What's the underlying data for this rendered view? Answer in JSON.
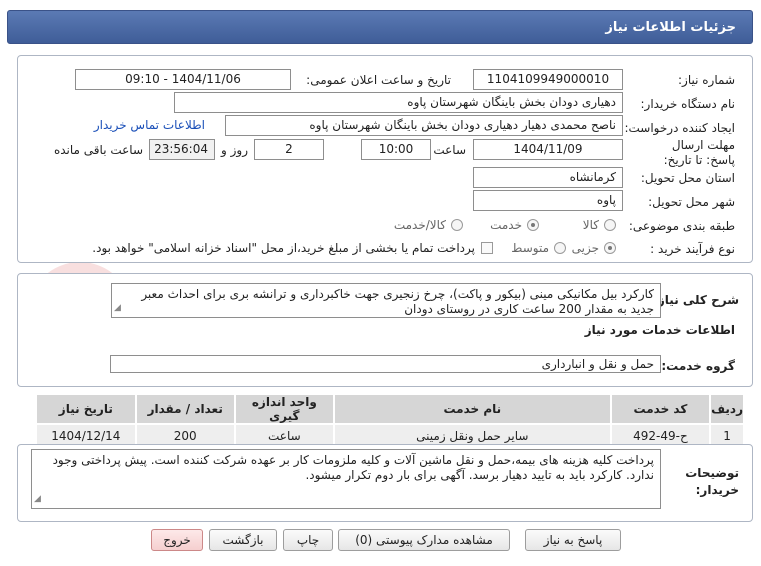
{
  "header": {
    "title": "جزئیات اطلاعات نیاز"
  },
  "form": {
    "need_number_label": "شماره نیاز:",
    "need_number": "1104109949000010",
    "announce_label": "تاریخ و ساعت اعلان عمومی:",
    "announce_value": "1404/11/06 - 09:10",
    "buyer_org_label": "نام دستگاه خریدار:",
    "buyer_org": "دهیاری دودان بخش باینگان شهرستان پاوه",
    "creator_label": "ایجاد کننده درخواست:",
    "creator": "ناصح محمدی دهیار دهیاری دودان بخش باینگان شهرستان پاوه",
    "contact_link": "اطلاعات تماس خریدار",
    "deadline_label": "مهلت ارسال پاسخ: تا تاریخ:",
    "deadline_date": "1404/11/09",
    "time_label": "ساعت",
    "deadline_time": "10:00",
    "days_value": "2",
    "days_label": "روز و",
    "remaining_time": "23:56:04",
    "remaining_label": "ساعت باقی مانده",
    "province_label": "استان محل تحویل:",
    "province": "کرمانشاه",
    "city_label": "شهر محل تحویل:",
    "city": "پاوه",
    "category_label": "طبقه بندی موضوعی:",
    "category_options": [
      "کالا",
      "خدمت",
      "کالا/خدمت"
    ],
    "purchase_type_label": "نوع فرآیند خرید :",
    "purchase_options": [
      "جزیی",
      "متوسط"
    ],
    "purchase_note": "پرداخت تمام یا بخشی از مبلغ خرید،از محل \"اسناد خزانه اسلامی\" خواهد بود."
  },
  "summary": {
    "label": "شرح کلی نیاز:",
    "text": "کارکرد بیل مکانیکی مینی (بیکور و پاکت)، چرخ زنجیری جهت خاکبرداری و ترانشه بری برای احداث معبر جدید به مقدار 200 ساعت کاری در روستای دودان"
  },
  "services": {
    "heading": "اطلاعات خدمات مورد نیاز",
    "group_label": "گروه خدمت:",
    "group_value": "حمل و نقل و انبارداری",
    "columns": [
      "ردیف",
      "کد خدمت",
      "نام خدمت",
      "واحد اندازه گیری",
      "تعداد / مقدار",
      "تاریخ نیاز"
    ],
    "rows": [
      [
        "1",
        "ح-49-492",
        "سایر حمل ونقل زمینی",
        "ساعت",
        "200",
        "1404/12/14"
      ]
    ]
  },
  "buyer_notes": {
    "label": "توضیحات خریدار:",
    "text": "پرداخت کلیه هزینه های بیمه،حمل و نقل ماشین آلات و کلیه ملزومات کار بر عهده شرکت کننده است. پیش پرداختی وجود ندارد. کارکرد باید به تایید دهیار برسد. آگهی برای بار دوم تکرار میشود."
  },
  "buttons": {
    "reply": "پاسخ به نیاز",
    "attachments": "مشاهده مدارک پیوستی (0)",
    "print": "چاپ",
    "back": "بازگشت",
    "exit": "خروج"
  },
  "colors": {
    "header_bg": "#4a68a6",
    "link": "#1a4fb8",
    "exit_bg": "#f5cfcf"
  },
  "watermark": "AriaTender.net"
}
